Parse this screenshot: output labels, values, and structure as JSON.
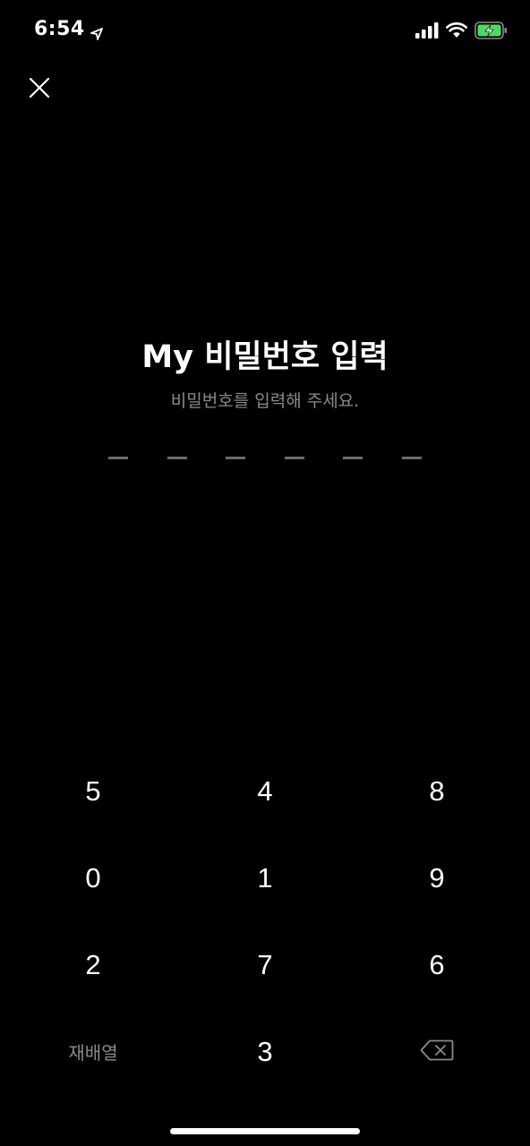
{
  "status_bar": {
    "time": "6:54",
    "icons": [
      "location-arrow-icon",
      "cellular-signal-icon",
      "wifi-icon",
      "battery-charging-icon"
    ]
  },
  "header": {
    "close_icon": "close-icon"
  },
  "main": {
    "title": "My 비밀번호 입력",
    "subtitle": "비밀번호를 입력해 주세요."
  },
  "pin": {
    "length": 6,
    "entered": 0
  },
  "keypad": {
    "row1": [
      "5",
      "4",
      "8"
    ],
    "row2": [
      "0",
      "1",
      "9"
    ],
    "row3": [
      "2",
      "7",
      "6"
    ],
    "shuffle_label": "재배열",
    "last_digit": "3",
    "backspace_icon": "backspace-icon"
  },
  "colors": {
    "background": "#000000",
    "text_primary": "#ffffff",
    "text_secondary": "#8a8a8a",
    "pin_dash": "#6b6b6b",
    "battery_charging": "#4cd964"
  }
}
